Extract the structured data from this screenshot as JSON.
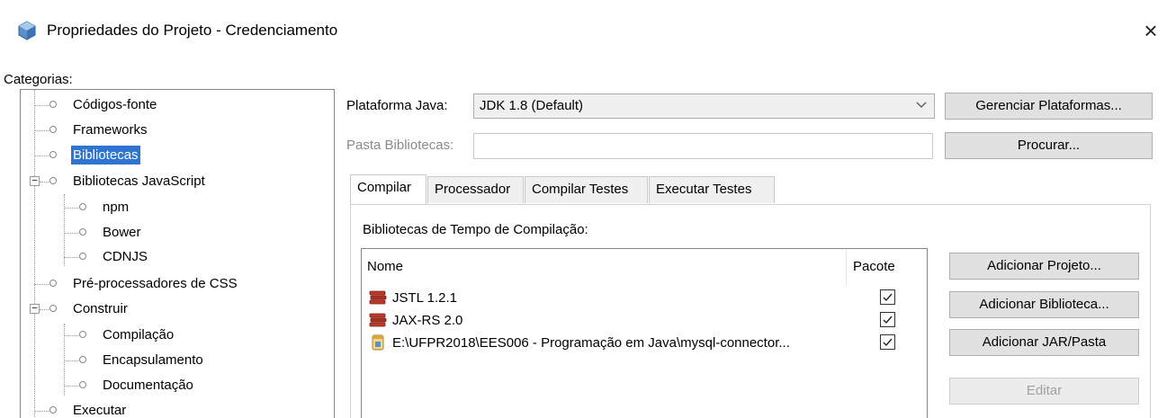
{
  "window": {
    "title": "Propriedades do Projeto - Credenciamento",
    "close_glyph": "×",
    "icon": "netbeans-project-icon"
  },
  "categories": {
    "label": "Categorias:",
    "items": [
      {
        "label": "Códigos-fonte",
        "level": 0,
        "selected": false
      },
      {
        "label": "Frameworks",
        "level": 0,
        "selected": false
      },
      {
        "label": "Bibliotecas",
        "level": 0,
        "selected": true
      },
      {
        "label": "Bibliotecas JavaScript",
        "level": 0,
        "expanded": true
      },
      {
        "label": "npm",
        "level": 1
      },
      {
        "label": "Bower",
        "level": 1
      },
      {
        "label": "CDNJS",
        "level": 1
      },
      {
        "label": "Pré-processadores de CSS",
        "level": 0
      },
      {
        "label": "Construir",
        "level": 0,
        "expanded": true
      },
      {
        "label": "Compilação",
        "level": 1
      },
      {
        "label": "Encapsulamento",
        "level": 1
      },
      {
        "label": "Documentação",
        "level": 1
      },
      {
        "label": "Executar",
        "level": 0
      }
    ]
  },
  "platform": {
    "label": "Plataforma Java:",
    "value": "JDK 1.8 (Default)",
    "manage_button": "Gerenciar Plataformas..."
  },
  "libfolder": {
    "label": "Pasta Bibliotecas:",
    "value": "",
    "browse_button": "Procurar..."
  },
  "tabs": [
    {
      "label": "Compilar",
      "active": true
    },
    {
      "label": "Processador",
      "active": false
    },
    {
      "label": "Compilar Testes",
      "active": false
    },
    {
      "label": "Executar Testes",
      "active": false
    }
  ],
  "compile": {
    "section_label": "Bibliotecas de Tempo de Compilação:",
    "columns": [
      "Nome",
      "Pacote"
    ],
    "rows": [
      {
        "name": "JSTL 1.2.1",
        "icon": "library-books-icon",
        "package": true
      },
      {
        "name": "JAX-RS 2.0",
        "icon": "library-books-icon",
        "package": true
      },
      {
        "name": "E:\\UFPR2018\\EES006 - Programação em Java\\mysql-connector...",
        "icon": "jar-file-icon",
        "package": true
      }
    ],
    "buttons": {
      "add_project": "Adicionar Projeto...",
      "add_library": "Adicionar Biblioteca...",
      "add_jar": "Adicionar JAR/Pasta",
      "edit": "Editar"
    }
  },
  "colors": {
    "selection": "#2f74d0",
    "button_bg": "#e1e1e1",
    "disabled_text": "#a0a0a0"
  }
}
